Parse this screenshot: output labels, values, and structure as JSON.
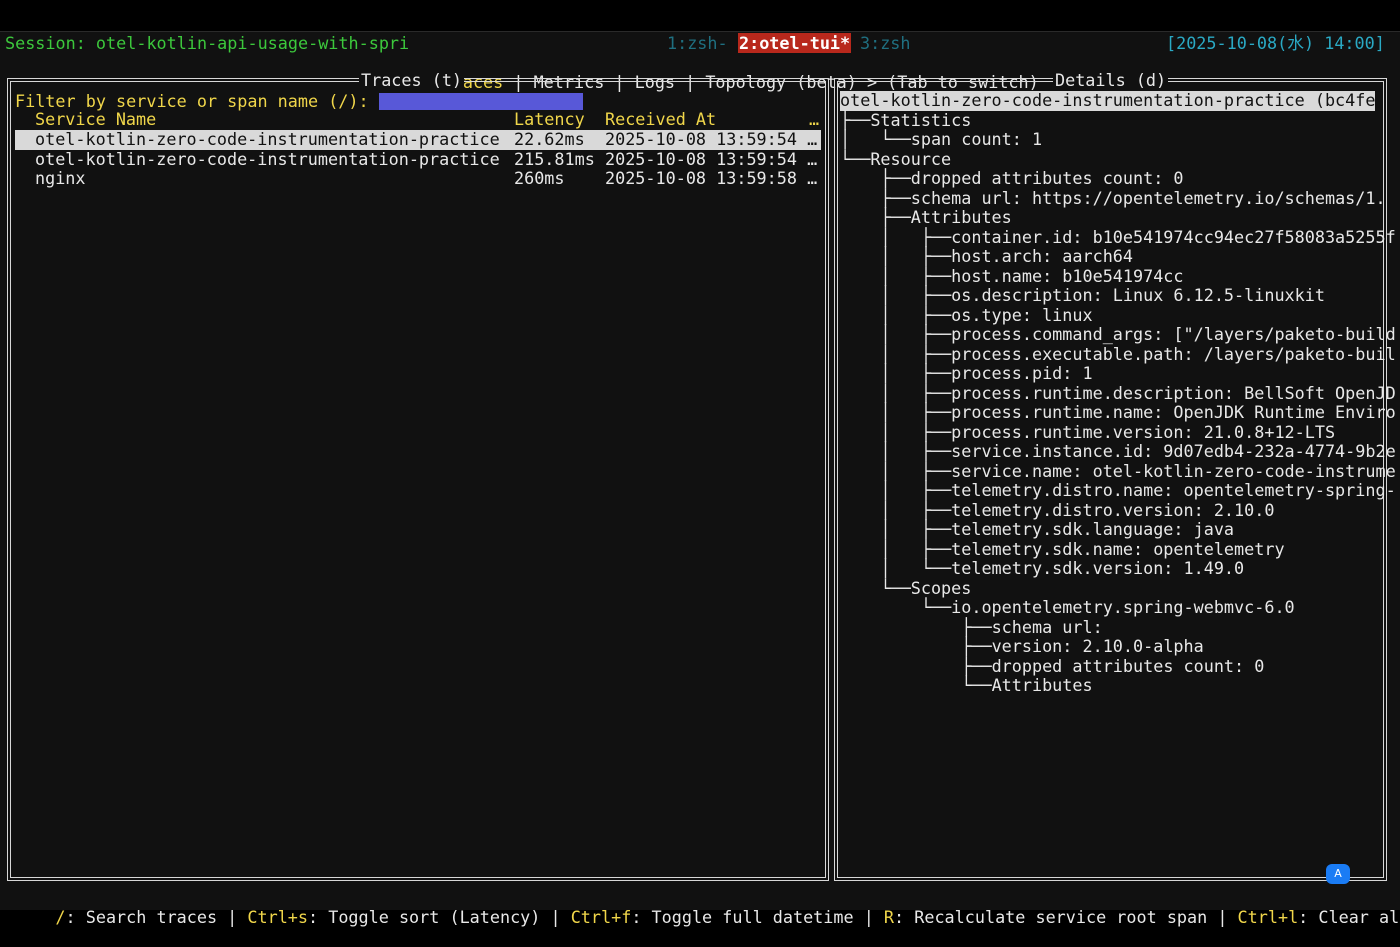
{
  "statusbar": {
    "session": "Session: otel-kotlin-api-usage-with-spri",
    "win1": "1:zsh-",
    "win2": "2:otel-tui*",
    "win3": "3:zsh",
    "clock": "[2025-10-08(水) 14:00]"
  },
  "nav": {
    "prev": "< ",
    "traces": "Traces",
    "rest": " | Metrics | Logs | Topology (beta) > (Tab to switch)"
  },
  "traces_panel": {
    "title": "Traces (t)",
    "filter_label": "Filter by service or span name (/):",
    "columns": [
      "Service Name",
      "Latency",
      "Received At",
      "…"
    ],
    "rows": [
      {
        "service": "otel-kotlin-zero-code-instrumentation-practice",
        "latency": "22.62ms",
        "received": "2025-10-08 13:59:54 …"
      },
      {
        "service": "otel-kotlin-zero-code-instrumentation-practice",
        "latency": "215.81ms",
        "received": "2025-10-08 13:59:54 …"
      },
      {
        "service": "nginx",
        "latency": "260ms",
        "received": "2025-10-08 13:59:58 …"
      }
    ]
  },
  "details_panel": {
    "title": "Details (d)",
    "header": "otel-kotlin-zero-code-instrumentation-practice (bc4fe",
    "tree": [
      {
        "prefix": "├──",
        "text": "Statistics"
      },
      {
        "prefix": "│   └──",
        "text": "span count: 1"
      },
      {
        "prefix": "└──",
        "text": "Resource"
      },
      {
        "prefix": "    ├──",
        "text": "dropped attributes count: 0"
      },
      {
        "prefix": "    ├──",
        "text": "schema url: https://opentelemetry.io/schemas/1."
      },
      {
        "prefix": "    ├──",
        "text": "Attributes"
      },
      {
        "prefix": "    │   ├──",
        "text": "container.id: b10e541974cc94ec27f58083a5255f"
      },
      {
        "prefix": "    │   ├──",
        "text": "host.arch: aarch64"
      },
      {
        "prefix": "    │   ├──",
        "text": "host.name: b10e541974cc"
      },
      {
        "prefix": "    │   ├──",
        "text": "os.description: Linux 6.12.5-linuxkit"
      },
      {
        "prefix": "    │   ├──",
        "text": "os.type: linux"
      },
      {
        "prefix": "    │   ├──",
        "text": "process.command_args: [\"/layers/paketo-build"
      },
      {
        "prefix": "    │   ├──",
        "text": "process.executable.path: /layers/paketo-buil"
      },
      {
        "prefix": "    │   ├──",
        "text": "process.pid: 1"
      },
      {
        "prefix": "    │   ├──",
        "text": "process.runtime.description: BellSoft OpenJD"
      },
      {
        "prefix": "    │   ├──",
        "text": "process.runtime.name: OpenJDK Runtime Enviro"
      },
      {
        "prefix": "    │   ├──",
        "text": "process.runtime.version: 21.0.8+12-LTS"
      },
      {
        "prefix": "    │   ├──",
        "text": "service.instance.id: 9d07edb4-232a-4774-9b2e"
      },
      {
        "prefix": "    │   ├──",
        "text": "service.name: otel-kotlin-zero-code-instrume"
      },
      {
        "prefix": "    │   ├──",
        "text": "telemetry.distro.name: opentelemetry-spring-"
      },
      {
        "prefix": "    │   ├──",
        "text": "telemetry.distro.version: 2.10.0"
      },
      {
        "prefix": "    │   ├──",
        "text": "telemetry.sdk.language: java"
      },
      {
        "prefix": "    │   ├──",
        "text": "telemetry.sdk.name: opentelemetry"
      },
      {
        "prefix": "    │   └──",
        "text": "telemetry.sdk.version: 1.49.0"
      },
      {
        "prefix": "    └──",
        "text": "Scopes"
      },
      {
        "prefix": "        └──",
        "text": "io.opentelemetry.spring-webmvc-6.0"
      },
      {
        "prefix": "            ├──",
        "text": "schema url:"
      },
      {
        "prefix": "            ├──",
        "text": "version: 2.10.0-alpha"
      },
      {
        "prefix": "            ├──",
        "text": "dropped attributes count: 0"
      },
      {
        "prefix": "            └──",
        "text": "Attributes"
      }
    ]
  },
  "footer": [
    {
      "key": "/",
      "desc": ": Search traces | "
    },
    {
      "key": "Ctrl+s",
      "desc": ": Toggle sort (Latency) | "
    },
    {
      "key": "Ctrl+f",
      "desc": ": Toggle full datetime | "
    },
    {
      "key": "R",
      "desc": ": Recalculate service root span | "
    },
    {
      "key": "Ctrl+l",
      "desc": ": Clear all"
    }
  ],
  "badge": "A",
  "colors": {
    "accent_yellow": "#f0d64a",
    "session_green": "#3cc83c",
    "active_tab_red": "#b8281c",
    "filter_blue": "#5858d8"
  }
}
